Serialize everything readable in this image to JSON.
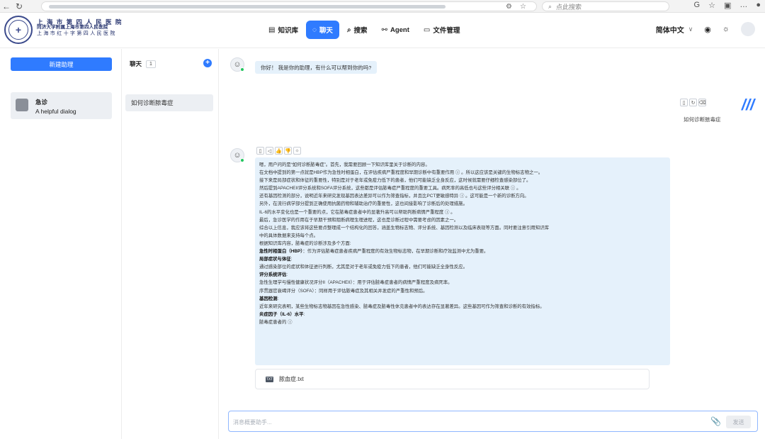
{
  "browser": {
    "back_icon": "←",
    "refresh_icon": "↻",
    "search_placeholder": "点此搜索",
    "search_icon": "⌕"
  },
  "header": {
    "hospital_name_cn": "上 海 市 第 四 人 民 医 院",
    "hospital_subtitle": "同济大学附属上海市第四人民医院",
    "hospital_alias": "上海市红十字第四人民医院",
    "logo_glyph": "+",
    "nav": [
      {
        "label": "知识库",
        "icon": "database-icon",
        "glyph": "▤"
      },
      {
        "label": "聊天",
        "icon": "chat-icon",
        "glyph": "◌"
      },
      {
        "label": "搜索",
        "icon": "search-icon",
        "glyph": "⌕"
      },
      {
        "label": "Agent",
        "icon": "agent-icon",
        "glyph": "⚯"
      },
      {
        "label": "文件管理",
        "icon": "folder-icon",
        "glyph": "▭"
      }
    ],
    "language": "简体中文",
    "github_glyph": "◉",
    "theme_glyph": "☼"
  },
  "assistants": {
    "new_button": "新建助理",
    "items": [
      {
        "name": "急诊",
        "description": "A helpful dialog"
      }
    ]
  },
  "chat_list": {
    "title": "聊天",
    "count": "1",
    "add_glyph": "+",
    "items": [
      {
        "title": "如何诊断脓毒症"
      }
    ]
  },
  "messages": {
    "greeting": "你好！ 我是你的助理，有什么可以帮到你的吗?",
    "user_question": "如何诊断脓毒症",
    "user_actions": [
      "▯",
      "↻",
      "⌫"
    ],
    "bot_actions": [
      "▯",
      "◁",
      "👍",
      "👎",
      "☼"
    ],
    "answer_lines": [
      {
        "text": "嗯，用户问的是“如何诊断脓毒症”。首先，我需要回顾一下知识库里关于诊断的内容。",
        "bold": false
      },
      {
        "text": "在文档中提到的第一点就是HBP作为急性时相蛋白，在评估疾病严重程度和早期诊断中有重要作用 ⓘ 。所以这应该是关键的生物标志物之一。",
        "bold": false
      },
      {
        "text": "接下来是局部症状和体征的重要性，特别是对于老年或免疫力低下的患者，他们可能缺乏全身反应，这时候就需要仔细检查感染部位了。",
        "bold": false
      },
      {
        "text": "然后提到APACHEII评分系统和SOFA评分系统，这些都是评估脓毒症严重程度的重要工具。病死率的高低也与这些评分相关联 ⓘ 。",
        "bold": false
      },
      {
        "text": "还有基因检测的部分，说明近年来研究发现基因表达差异可以作为筛查指标，并且比PCT更敏感特异 ⓘ 。这可能是一个新的诊断方向。",
        "bold": false
      },
      {
        "text": "另外，在流行病学部分提到正确使用抗菌药物和辅助治疗的重要性，这也间接影响了诊断后的处理措施。",
        "bold": false
      },
      {
        "text": "IL-6的水平变化也是一个重要的点，它在脓毒症患者中的显著升高可以帮助判断病情严重程度 ⓘ 。",
        "bold": false
      },
      {
        "text": "最后，急诊医学的作用在于早期干预和阻断病理生理进程，这也是诊断过程中需要考虑的因素之一。",
        "bold": false
      },
      {
        "text": "综合以上信息，我应该将这些要点整理成一个结构化的回答，涵盖生物标志物、评分系统、基因检测以及临床表现等方面。同时要注意引用知识库",
        "bold": false
      },
      {
        "text": "中的具体数据来支持每个点。",
        "bold": false
      },
      {
        "text": "根据知识库内容，脓毒症的诊断涉及多个方面:",
        "bold": false
      },
      {
        "text": "急性时相蛋白（HBP）",
        "bold": true,
        "suffix": "：作为评估脓毒症患者疾病严重程度的有效生物标志物，在早期诊断和疗效监测中尤为重要。"
      },
      {
        "text": "局部症状与体征",
        "bold": true,
        "suffix": ":"
      },
      {
        "text": "通过感染部位的症状和体征进行判断，尤其是对于老年或免疫力低下的患者，他们可能缺乏全身性反应。",
        "bold": false
      },
      {
        "text": "评分系统评估",
        "bold": true,
        "suffix": ":"
      },
      {
        "text": "急性生理学与慢性健康状况评分II（APACHEII）：用于评估脓毒症患者的病情严重程度及病死率。",
        "bold": false
      },
      {
        "text": "序贯器官衰竭评分（SOFA）：同样用于评估脓毒症及其相关并发症的严重性和预后。",
        "bold": false
      },
      {
        "text": "基因检测",
        "bold": true,
        "suffix": ":"
      },
      {
        "text": "近年来研究表明，某些生物标志物基因在急性感染、脓毒症及脓毒性休克患者中的表达存在显著差异。这些基因可作为筛查和诊断的有效指标。",
        "bold": false
      },
      {
        "text": "炎症因子（IL-6）水平",
        "bold": true,
        "suffix": ":"
      },
      {
        "text": "脓毒症患者的 ⓘ",
        "bold": false
      }
    ],
    "attachment": "脓血症.txt",
    "attachment_badge": "TXT"
  },
  "input": {
    "placeholder": "消息概要助手...",
    "value": "",
    "send_label": "发送",
    "attach_glyph": "📎"
  }
}
